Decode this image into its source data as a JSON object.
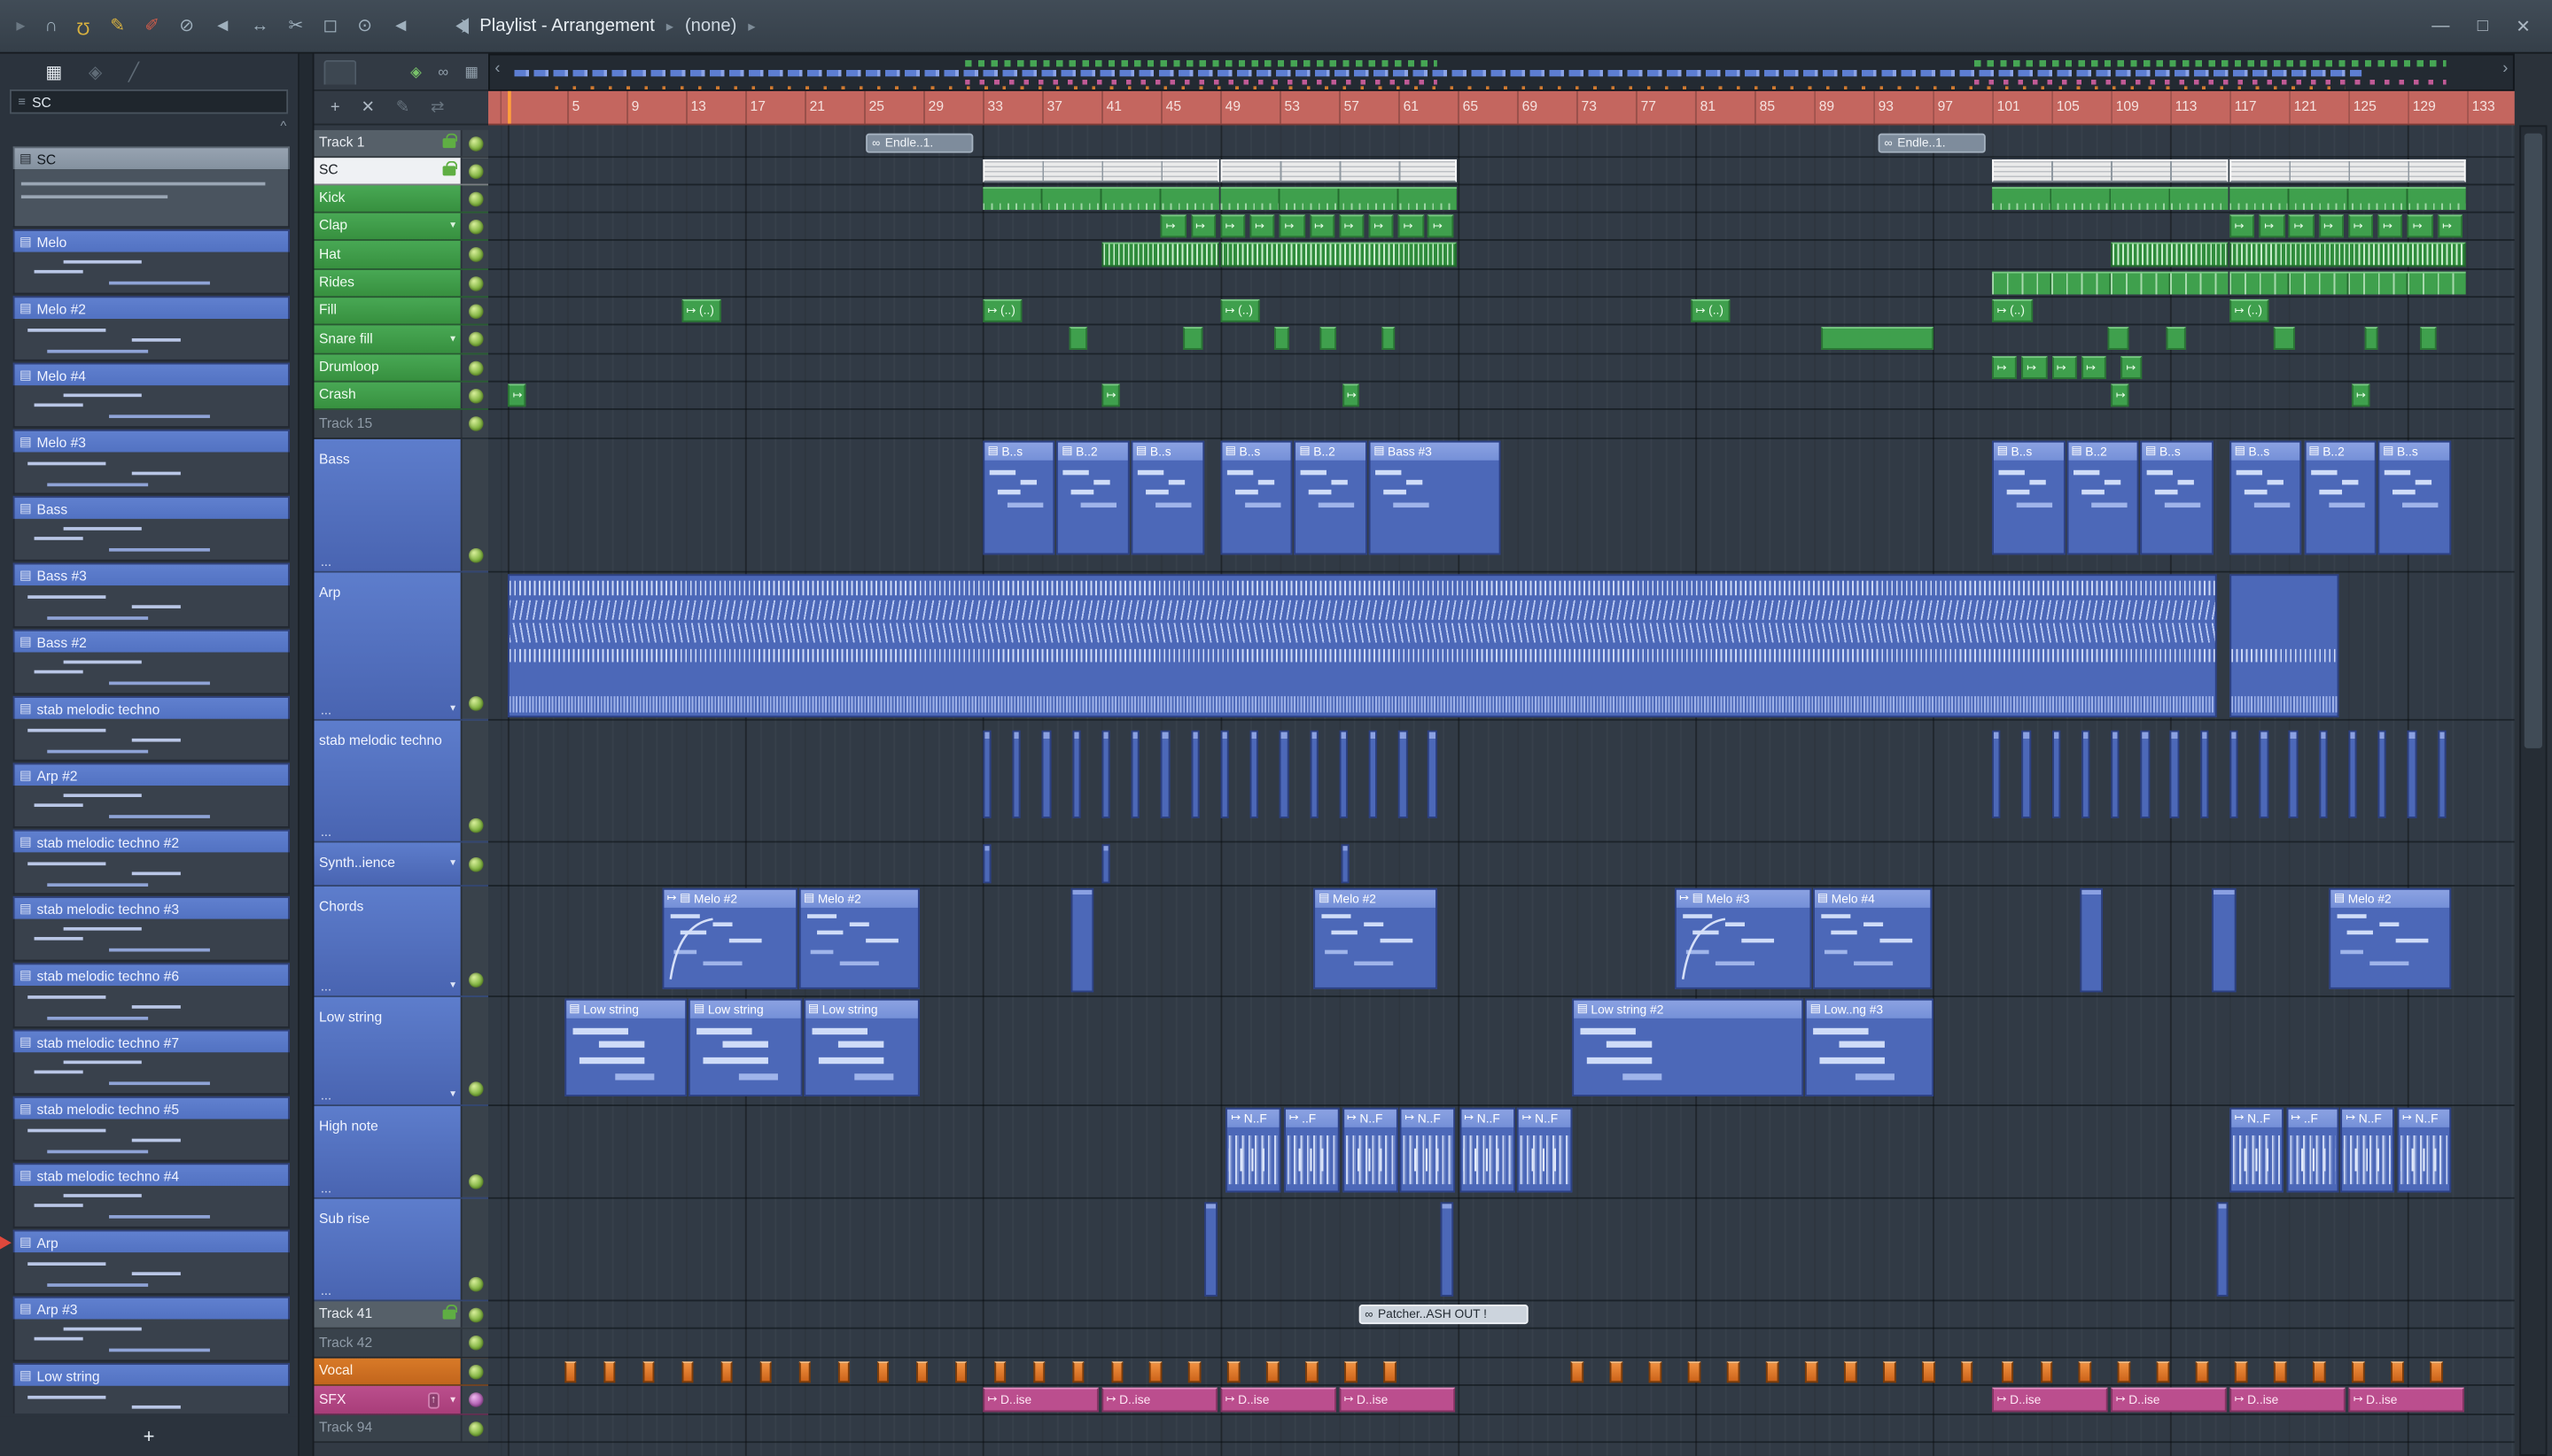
{
  "titlebar": {
    "title": "Playlist - Arrangement",
    "crumb_sep": "▸",
    "subtitle": "(none)",
    "window_controls": [
      {
        "name": "minimize-button",
        "glyph": "—"
      },
      {
        "name": "maximize-button",
        "glyph": "□"
      },
      {
        "name": "close-button",
        "glyph": "✕"
      }
    ]
  },
  "toolbar": {
    "icons": [
      {
        "name": "collapse-arrow-icon",
        "glyph": "▸",
        "cls": "dim"
      },
      {
        "name": "headphones-icon",
        "glyph": "∩",
        "cls": ""
      },
      {
        "name": "magnet-icon",
        "glyph": "Ω",
        "cls": "amber flip"
      },
      {
        "name": "draw-pencil-icon",
        "glyph": "✎",
        "cls": "amber"
      },
      {
        "name": "paint-brush-icon",
        "glyph": "✐",
        "cls": "red"
      },
      {
        "name": "delete-tool-icon",
        "glyph": "⊘",
        "cls": ""
      },
      {
        "name": "mute-tool-icon",
        "glyph": "◄",
        "cls": ""
      },
      {
        "name": "slip-tool-icon",
        "glyph": "↔",
        "cls": ""
      },
      {
        "name": "slice-tool-icon",
        "glyph": "✂",
        "cls": ""
      },
      {
        "name": "select-tool-icon",
        "glyph": "◻",
        "cls": ""
      },
      {
        "name": "zoom-tool-icon",
        "glyph": "⊙",
        "cls": ""
      },
      {
        "name": "playback-tool-icon",
        "glyph": "◄",
        "cls": ""
      }
    ]
  },
  "pattern_picker": {
    "tools": [
      {
        "name": "layers-icon",
        "glyph": "▦",
        "cls": "bright"
      },
      {
        "name": "split-icon",
        "glyph": "◈",
        "cls": "dim"
      },
      {
        "name": "line-icon",
        "glyph": "╱",
        "cls": "dim"
      }
    ],
    "selector_value": "SC",
    "scroll_up_glyph": "^",
    "selected": "SC",
    "patterns": [
      "SC",
      "Melo",
      "Melo #2",
      "Melo #4",
      "Melo #3",
      "Bass",
      "Bass #3",
      "Bass #2",
      "stab melodic techno",
      "Arp #2",
      "stab melodic techno #2",
      "stab melodic techno #3",
      "stab melodic techno #6",
      "stab melodic techno #7",
      "stab melodic techno #5",
      "stab melodic techno #4",
      "Arp",
      "Arp #3",
      "Low string"
    ],
    "add_label": "+"
  },
  "playlist": {
    "header_tools_row1": [
      {
        "name": "target-icon",
        "glyph": "◈",
        "cls": "grn"
      },
      {
        "name": "link-icon",
        "glyph": "∞",
        "cls": ""
      },
      {
        "name": "grid-view-icon",
        "glyph": "▦",
        "cls": ""
      }
    ],
    "header_tools_row2": [
      {
        "name": "add-button",
        "glyph": "+",
        "cls": ""
      },
      {
        "name": "delete-button",
        "glyph": "✕",
        "cls": ""
      },
      {
        "name": "edit-icon",
        "glyph": "✎",
        "cls": "dim"
      },
      {
        "name": "swap-icon",
        "glyph": "⇄",
        "cls": "dim"
      }
    ],
    "ruler_numbers": [
      5,
      9,
      13,
      17,
      21,
      25,
      29,
      33,
      37,
      41,
      45,
      49,
      53,
      57,
      61,
      65,
      69,
      73,
      77,
      81,
      85,
      89,
      93,
      97,
      101,
      105,
      109,
      113,
      117,
      121,
      125,
      129,
      133
    ],
    "tracks": [
      {
        "name": "Track 1",
        "style": "plain",
        "h": 17,
        "locked": true,
        "clips": [
          {
            "type": "chip",
            "b": 25.1,
            "len": 7.4,
            "label": "Endle..1.",
            "icon": "∞"
          },
          {
            "type": "chip",
            "b": 93.3,
            "len": 7.4,
            "label": "Endle..1.",
            "icon": "∞"
          }
        ]
      },
      {
        "name": "SC",
        "style": "selected",
        "h": 17,
        "locked": true,
        "clips": [
          {
            "type": "white",
            "b": 33,
            "len": 16
          },
          {
            "type": "white",
            "b": 49,
            "len": 16
          },
          {
            "type": "white",
            "b": 101,
            "len": 16
          },
          {
            "type": "white",
            "b": 117,
            "len": 16
          }
        ]
      },
      {
        "name": "Kick",
        "style": "green",
        "h": 17,
        "clips": [
          {
            "type": "gsolid",
            "b": 33,
            "len": 16
          },
          {
            "type": "gsolid",
            "b": 49,
            "len": 16
          },
          {
            "type": "gsolid",
            "b": 101,
            "len": 16
          },
          {
            "type": "gsolid",
            "b": 117,
            "len": 16
          }
        ]
      },
      {
        "name": "Clap",
        "style": "green",
        "h": 17,
        "dd": true,
        "clips": [
          {
            "type": "garrow",
            "series": true,
            "b": 45,
            "step": 2,
            "count": 10,
            "len": 1.8
          },
          {
            "type": "garrow",
            "series": true,
            "b": 117,
            "step": 2,
            "count": 8,
            "len": 1.8
          }
        ]
      },
      {
        "name": "Hat",
        "style": "green",
        "h": 18,
        "clips": [
          {
            "type": "ghatch",
            "b": 41,
            "len": 8
          },
          {
            "type": "ghatch",
            "b": 49,
            "len": 16
          },
          {
            "type": "ghatch",
            "b": 109,
            "len": 8
          },
          {
            "type": "ghatch",
            "b": 117,
            "len": 16
          }
        ]
      },
      {
        "name": "Rides",
        "style": "green",
        "h": 17,
        "clips": [
          {
            "type": "gticks",
            "b": 101,
            "len": 16
          },
          {
            "type": "gticks",
            "b": 117,
            "len": 16
          }
        ]
      },
      {
        "name": "Fill",
        "style": "green",
        "h": 17,
        "clips": [
          {
            "type": "glabel",
            "b": 12.7,
            "len": 2.8,
            "label": "(..)"
          },
          {
            "type": "glabel",
            "b": 33,
            "len": 2.8,
            "label": "(..)"
          },
          {
            "type": "glabel",
            "b": 49,
            "len": 2.8,
            "label": "(..)"
          },
          {
            "type": "glabel",
            "b": 80.7,
            "len": 2.8,
            "label": "(..)"
          },
          {
            "type": "glabel",
            "b": 101,
            "len": 2.8,
            "label": "(..)"
          },
          {
            "type": "glabel",
            "b": 117,
            "len": 2.8,
            "label": "(..)"
          }
        ]
      },
      {
        "name": "Snare fill",
        "style": "green",
        "h": 18,
        "dd": true,
        "clips": [
          {
            "type": "gblock",
            "b": 38.8,
            "len": 1.4
          },
          {
            "type": "gblock",
            "b": 46.5,
            "len": 1.4
          },
          {
            "type": "gblock",
            "b": 52.6,
            "len": 1.2
          },
          {
            "type": "gblock",
            "b": 55.7,
            "len": 1.2
          },
          {
            "type": "gblock",
            "b": 59.9,
            "len": 1
          },
          {
            "type": "gblock",
            "b": 89.5,
            "len": 7.7
          },
          {
            "type": "gblock",
            "b": 108.8,
            "len": 1.5
          },
          {
            "type": "gblock",
            "b": 112.7,
            "len": 1.5
          },
          {
            "type": "gblock",
            "b": 120,
            "len": 1.5
          },
          {
            "type": "gblock",
            "b": 126.1,
            "len": 1
          },
          {
            "type": "gblock",
            "b": 129.8,
            "len": 1.2
          }
        ]
      },
      {
        "name": "Drumloop",
        "style": "green",
        "h": 17,
        "clips": [
          {
            "type": "garrow",
            "series": true,
            "b": 101,
            "step": 2,
            "count": 4,
            "len": 1.8
          },
          {
            "type": "garrow",
            "b": 109.7,
            "len": 1.5
          }
        ]
      },
      {
        "name": "Crash",
        "style": "green",
        "h": 17,
        "clips": [
          {
            "type": "garrow",
            "b": 1,
            "len": 1.3
          },
          {
            "type": "garrow",
            "b": 41,
            "len": 1.3
          },
          {
            "type": "garrow",
            "b": 57.2,
            "len": 1.3
          },
          {
            "type": "garrow",
            "b": 109,
            "len": 1.3
          },
          {
            "type": "garrow",
            "b": 125.2,
            "len": 1.3
          }
        ]
      },
      {
        "name": "Track 15",
        "style": "dim",
        "h": 18,
        "clips": []
      },
      {
        "name": "Bass",
        "style": "blue",
        "h": 82,
        "clipH": 70,
        "tex": "bass",
        "more": true,
        "clips": [
          {
            "type": "pat",
            "b": 33,
            "len": 5,
            "label": "B..s"
          },
          {
            "type": "pat",
            "b": 38,
            "len": 5,
            "label": "B..2"
          },
          {
            "type": "pat",
            "b": 43,
            "len": 5,
            "label": "B..s"
          },
          {
            "type": "pat",
            "b": 49,
            "len": 5,
            "label": "B..s"
          },
          {
            "type": "pat",
            "b": 54,
            "len": 5,
            "label": "B..2"
          },
          {
            "type": "pat",
            "b": 59,
            "len": 9,
            "label": "Bass #3"
          },
          {
            "type": "pat",
            "b": 101,
            "len": 5,
            "label": "B..s"
          },
          {
            "type": "pat",
            "b": 106,
            "len": 5,
            "label": "B..2"
          },
          {
            "type": "pat",
            "b": 111,
            "len": 5,
            "label": "B..s"
          },
          {
            "type": "pat",
            "b": 117,
            "len": 5,
            "label": "B..s"
          },
          {
            "type": "pat",
            "b": 122,
            "len": 5,
            "label": "B..2"
          },
          {
            "type": "pat",
            "b": 127,
            "len": 5,
            "label": "B..s"
          }
        ]
      },
      {
        "name": "Arp",
        "style": "blue",
        "h": 91,
        "dd": true,
        "more": true,
        "clips": [
          {
            "type": "arp",
            "b": 1,
            "len": 115.2
          },
          {
            "type": "arp2",
            "b": 117,
            "len": 7.5
          }
        ]
      },
      {
        "name": "stab melodic techno",
        "style": "blue",
        "h": 75,
        "more": true,
        "clips": [
          {
            "type": "cols",
            "series": true,
            "b": 33,
            "step": 2,
            "count": 16,
            "len": 0.7
          },
          {
            "type": "cols",
            "series": true,
            "b": 101,
            "step": 2,
            "count": 16,
            "len": 0.7
          }
        ]
      },
      {
        "name": "Synth..ience",
        "style": "blue",
        "h": 27,
        "dd": true,
        "clips": [
          {
            "type": "thin",
            "b": 33,
            "len": 0.7
          },
          {
            "type": "thin",
            "b": 41,
            "len": 0.7
          },
          {
            "type": "thin",
            "b": 57.1,
            "len": 0.7
          }
        ]
      },
      {
        "name": "Chords",
        "style": "blue",
        "h": 68,
        "clipH": 62,
        "tex": "chords",
        "dd": true,
        "more": true,
        "clips": [
          {
            "type": "pat",
            "b": 11.4,
            "len": 9.2,
            "label": "Melo #2",
            "arrow": true,
            "curve": true
          },
          {
            "type": "pat",
            "b": 20.6,
            "len": 8.2,
            "label": "Melo #2"
          },
          {
            "type": "pat",
            "b": 55.3,
            "len": 8.4,
            "label": "Melo #2"
          },
          {
            "type": "pat",
            "b": 79.6,
            "len": 9.3,
            "label": "Melo #3",
            "arrow": true,
            "curve": true
          },
          {
            "type": "pat",
            "b": 88.9,
            "len": 8.2,
            "label": "Melo #4"
          },
          {
            "type": "pat",
            "b": 123.7,
            "len": 8.3,
            "label": "Melo #2"
          },
          {
            "type": "thin2",
            "b": 38.9,
            "len": 1.7
          },
          {
            "type": "thin2",
            "b": 106.9,
            "len": 1.7
          },
          {
            "type": "thin2",
            "b": 115.8,
            "len": 1.7
          }
        ]
      },
      {
        "name": "Low string",
        "style": "blue",
        "h": 67,
        "clipH": 60,
        "tex": "low",
        "dd": true,
        "more": true,
        "clips": [
          {
            "type": "pat",
            "b": 4.8,
            "len": 8.4,
            "label": "Low string"
          },
          {
            "type": "pat",
            "b": 13.2,
            "len": 7.8,
            "label": "Low string"
          },
          {
            "type": "pat",
            "b": 20.9,
            "len": 7.9,
            "label": "Low string"
          },
          {
            "type": "pat",
            "b": 72.7,
            "len": 15.7,
            "label": "Low string #2"
          },
          {
            "type": "pat",
            "b": 88.4,
            "len": 8.8,
            "label": "Low..ng #3"
          }
        ]
      },
      {
        "name": "High note",
        "style": "blue",
        "h": 57,
        "clipH": 52,
        "more": true,
        "clips": [
          {
            "type": "audio",
            "b": 49.4,
            "len": 3.85,
            "label": "N..F",
            "arrow": true
          },
          {
            "type": "audio",
            "b": 53.3,
            "len": 3.85,
            "label": "..F",
            "arrow": true
          },
          {
            "type": "audio",
            "b": 57.2,
            "len": 3.85,
            "label": "N..F",
            "arrow": true
          },
          {
            "type": "audio",
            "b": 61.1,
            "len": 3.85,
            "label": "N..F",
            "arrow": true
          },
          {
            "type": "audio",
            "b": 65.1,
            "len": 3.85,
            "label": "N..F",
            "arrow": true
          },
          {
            "type": "audio",
            "b": 69,
            "len": 3.85,
            "label": "N..F",
            "arrow": true
          },
          {
            "type": "audio",
            "b": 117,
            "len": 3.7,
            "label": "N..F",
            "arrow": true
          },
          {
            "type": "audio",
            "b": 120.8,
            "len": 3.7,
            "label": "..F",
            "arrow": true
          },
          {
            "type": "audio",
            "b": 124.5,
            "len": 3.7,
            "label": "N..F",
            "arrow": true
          },
          {
            "type": "audio",
            "b": 128.3,
            "len": 3.7,
            "label": "N..F",
            "arrow": true
          }
        ]
      },
      {
        "name": "Sub rise",
        "style": "blue",
        "h": 63,
        "more": true,
        "clips": [
          {
            "type": "thin3",
            "b": 47.9,
            "len": 1
          },
          {
            "type": "thin3",
            "b": 63.8,
            "len": 1
          },
          {
            "type": "thin3",
            "b": 116.1,
            "len": 0.9
          }
        ]
      },
      {
        "name": "Track 41",
        "style": "plain",
        "h": 17,
        "locked": true,
        "clips": [
          {
            "type": "chiplight",
            "b": 58.3,
            "len": 11.6,
            "label": "Patcher..ASH OUT !",
            "icon": "∞"
          }
        ]
      },
      {
        "name": "Track 42",
        "style": "dim",
        "h": 18,
        "clips": []
      },
      {
        "name": "Vocal",
        "style": "orange",
        "h": 17,
        "clips": [
          {
            "type": "orange",
            "b": 4.8,
            "to": 62,
            "step": 2.63,
            "len": 0.95
          },
          {
            "type": "orange",
            "b": 72.6,
            "to": 99.5,
            "step": 2.63,
            "len": 0.95
          },
          {
            "type": "orange",
            "b": 101.6,
            "to": 131.2,
            "step": 2.63,
            "len": 0.95
          }
        ]
      },
      {
        "name": "SFX",
        "style": "magenta",
        "h": 18,
        "dd": true,
        "up": true,
        "led": "purple",
        "clips": [
          {
            "type": "pink",
            "b": 33,
            "len": 7.9,
            "label": "D..ise"
          },
          {
            "type": "pink",
            "b": 41,
            "len": 7.9,
            "label": "D..ise"
          },
          {
            "type": "pink",
            "b": 49,
            "len": 7.9,
            "label": "D..ise"
          },
          {
            "type": "pink",
            "b": 57,
            "len": 7.9,
            "label": "D..ise"
          },
          {
            "type": "pink",
            "b": 101,
            "len": 7.9,
            "label": "D..ise"
          },
          {
            "type": "pink",
            "b": 109,
            "len": 7.9,
            "label": "D..ise"
          },
          {
            "type": "pink",
            "b": 117,
            "len": 7.9,
            "label": "D..ise"
          },
          {
            "type": "pink",
            "b": 125,
            "len": 7.9,
            "label": "D..ise"
          }
        ]
      },
      {
        "name": "Track 94",
        "style": "dim",
        "h": 17,
        "clips": []
      }
    ],
    "colors": {
      "green_clip": "#3fa04d",
      "blue_clip": "#4c68b8",
      "orange_clip": "#cd641a",
      "pink_clip": "#bb4e8e",
      "ruler": "#c4665f",
      "grid_bg": "#313a45"
    }
  }
}
